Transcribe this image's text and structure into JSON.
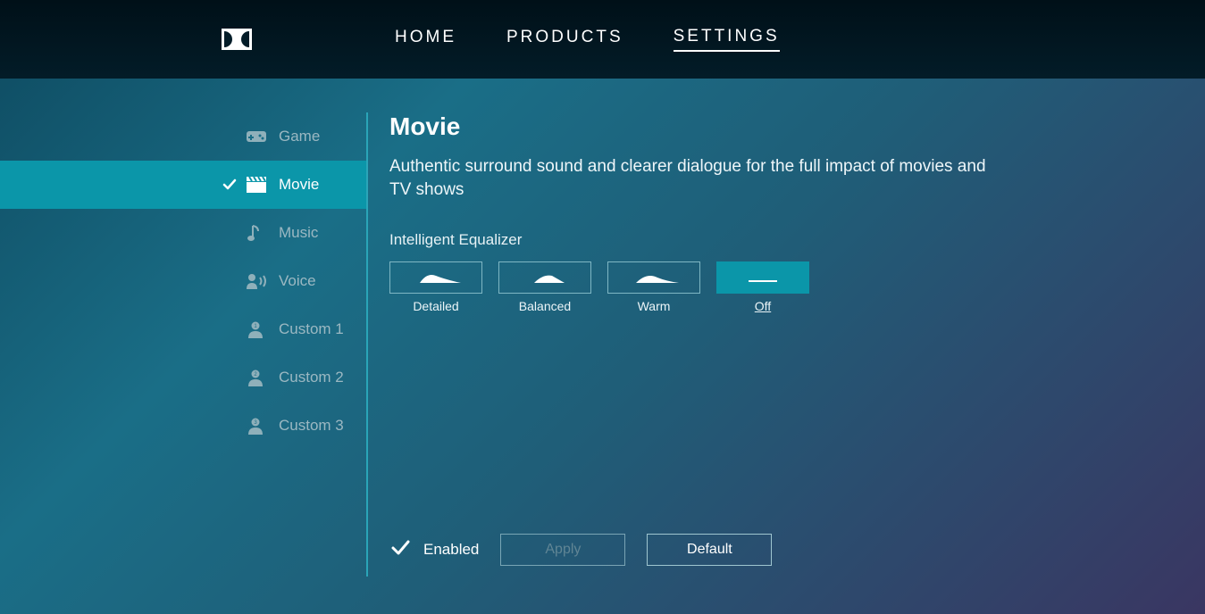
{
  "nav": {
    "items": [
      {
        "label": "HOME",
        "active": false
      },
      {
        "label": "PRODUCTS",
        "active": false
      },
      {
        "label": "SETTINGS",
        "active": true
      }
    ]
  },
  "sidebar": {
    "items": [
      {
        "label": "Game",
        "icon": "gamepad-icon",
        "active": false
      },
      {
        "label": "Movie",
        "icon": "clapper-icon",
        "active": true
      },
      {
        "label": "Music",
        "icon": "music-note-icon",
        "active": false
      },
      {
        "label": "Voice",
        "icon": "voice-icon",
        "active": false
      },
      {
        "label": "Custom 1",
        "icon": "user-1-icon",
        "active": false
      },
      {
        "label": "Custom 2",
        "icon": "user-2-icon",
        "active": false
      },
      {
        "label": "Custom 3",
        "icon": "user-3-icon",
        "active": false
      }
    ]
  },
  "content": {
    "title": "Movie",
    "description": "Authentic surround sound and clearer dialogue for the full impact of movies and TV shows",
    "eq_section_label": "Intelligent Equalizer",
    "eq_options": [
      {
        "label": "Detailed",
        "selected": false,
        "curve": "detailed"
      },
      {
        "label": "Balanced",
        "selected": false,
        "curve": "balanced"
      },
      {
        "label": "Warm",
        "selected": false,
        "curve": "warm"
      },
      {
        "label": "Off",
        "selected": true,
        "curve": "off"
      }
    ]
  },
  "footer": {
    "enabled_label": "Enabled",
    "enabled_checked": true,
    "apply_label": "Apply",
    "default_label": "Default"
  }
}
